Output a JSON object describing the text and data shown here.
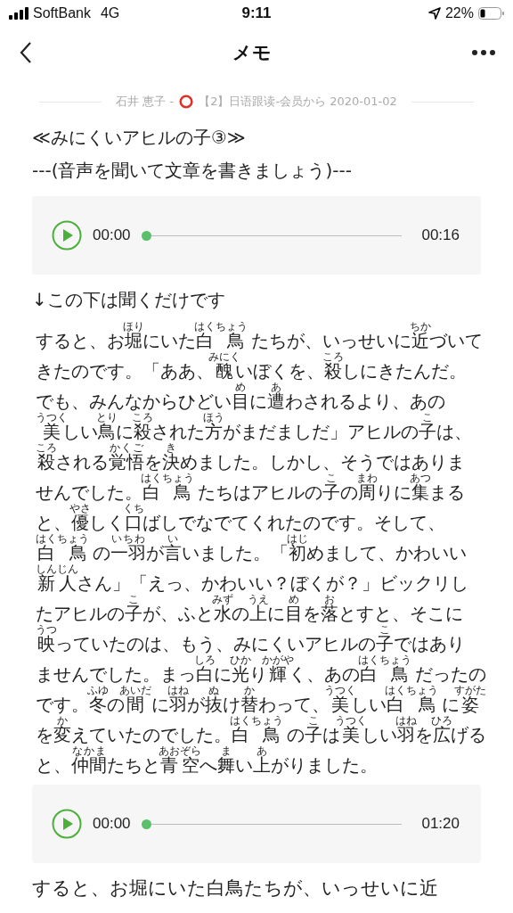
{
  "status_bar": {
    "carrier": "SoftBank",
    "network": "4G",
    "time": "9:11",
    "battery": "22%"
  },
  "nav": {
    "title": "メモ"
  },
  "meta": {
    "author": "石井 恵子 -",
    "source": "【2】日语跟读-会员から 2020-01-02"
  },
  "title_lines": [
    "≪みにくいアヒルの子③≫",
    "---(音声を聞いて文章を書きましょう)---"
  ],
  "players": [
    {
      "elapsed": "00:00",
      "duration": "00:16",
      "level": 0
    },
    {
      "elapsed": "00:00",
      "duration": "01:20",
      "level": 0
    }
  ],
  "note": "↓この下は聞くだけです",
  "passage": [
    [
      {
        "t": "すると、お"
      },
      {
        "t": "堀",
        "r": "ほり"
      },
      {
        "t": "にいた"
      },
      {
        "t": "白 鳥",
        "r": "はくちょう"
      },
      {
        "t": " たちが、いっせいに"
      },
      {
        "t": "近",
        "r": "ちか"
      },
      {
        "t": "づいて"
      }
    ],
    [
      {
        "t": "きたのです。「ああ、"
      },
      {
        "t": "醜",
        "r": "みにく"
      },
      {
        "t": "いぼくを、"
      },
      {
        "t": "殺",
        "r": "ころ"
      },
      {
        "t": "しにきたんだ。"
      }
    ],
    [
      {
        "t": "でも、みんなからひどい"
      },
      {
        "t": "目",
        "r": "め"
      },
      {
        "t": "に"
      },
      {
        "t": "遭",
        "r": "あ"
      },
      {
        "t": "わされるより、あの"
      }
    ],
    [
      {
        "t": "美",
        "r": "うつく"
      },
      {
        "t": "しい"
      },
      {
        "t": "鳥",
        "r": "とり"
      },
      {
        "t": "に"
      },
      {
        "t": "殺",
        "r": "ころ"
      },
      {
        "t": "された"
      },
      {
        "t": "方",
        "r": "ほう"
      },
      {
        "t": "がまだましだ」アヒルの"
      },
      {
        "t": "子",
        "r": "こ"
      },
      {
        "t": "は、"
      }
    ],
    [
      {
        "t": "殺",
        "r": "ころ"
      },
      {
        "t": "される"
      },
      {
        "t": "覚悟",
        "r": "かくご"
      },
      {
        "t": "を"
      },
      {
        "t": "決",
        "r": "き"
      },
      {
        "t": "めました。しかし、そうではありま"
      }
    ],
    [
      {
        "t": "せんでした。"
      },
      {
        "t": "白 鳥",
        "r": "はくちょう"
      },
      {
        "t": " たちはアヒルの"
      },
      {
        "t": "子",
        "r": "こ"
      },
      {
        "t": "の"
      },
      {
        "t": "周",
        "r": "まわ"
      },
      {
        "t": "りに"
      },
      {
        "t": "集",
        "r": "あつ"
      },
      {
        "t": "まる"
      }
    ],
    [
      {
        "t": "と、"
      },
      {
        "t": "優",
        "r": "やさ"
      },
      {
        "t": "しく"
      },
      {
        "t": "口",
        "r": "くち"
      },
      {
        "t": "ばしでなでてくれたのです。そして、"
      }
    ],
    [
      {
        "t": "白 鳥",
        "r": "はくちょう"
      },
      {
        "t": " の"
      },
      {
        "t": "一羽",
        "r": "いちわ"
      },
      {
        "t": "が"
      },
      {
        "t": "言",
        "r": "い"
      },
      {
        "t": "いました。「"
      },
      {
        "t": "初",
        "r": "はじ"
      },
      {
        "t": "めまして、かわいい"
      }
    ],
    [
      {
        "t": "新人",
        "r": "しんじん"
      },
      {
        "t": "さん」「えっ、かわいい？ぼくが？」ビックリし"
      }
    ],
    [
      {
        "t": "たアヒルの"
      },
      {
        "t": "子",
        "r": "こ"
      },
      {
        "t": "が、ふと"
      },
      {
        "t": "水",
        "r": "みず"
      },
      {
        "t": "の"
      },
      {
        "t": "上",
        "r": "うえ"
      },
      {
        "t": "に"
      },
      {
        "t": "目",
        "r": "め"
      },
      {
        "t": "を"
      },
      {
        "t": "落",
        "r": "お"
      },
      {
        "t": "とすと、そこに"
      }
    ],
    [
      {
        "t": "映",
        "r": "うつ"
      },
      {
        "t": "っていたのは、もう、みにくいアヒルの"
      },
      {
        "t": "子",
        "r": "こ"
      },
      {
        "t": "ではあり"
      }
    ],
    [
      {
        "t": "ませんでした。まっ"
      },
      {
        "t": "白",
        "r": "しろ"
      },
      {
        "t": "に"
      },
      {
        "t": "光",
        "r": "ひか"
      },
      {
        "t": "り"
      },
      {
        "t": "輝",
        "r": "かがや"
      },
      {
        "t": "く、あの"
      },
      {
        "t": "白 鳥",
        "r": "はくちょう"
      },
      {
        "t": " だったの"
      }
    ],
    [
      {
        "t": "です。"
      },
      {
        "t": "冬",
        "r": "ふゆ"
      },
      {
        "t": "の"
      },
      {
        "t": "間",
        "r": "あいだ"
      },
      {
        "t": " に"
      },
      {
        "t": "羽",
        "r": "はね"
      },
      {
        "t": "が"
      },
      {
        "t": "抜",
        "r": "ぬ"
      },
      {
        "t": "け"
      },
      {
        "t": "替",
        "r": "か"
      },
      {
        "t": "わって、"
      },
      {
        "t": "美",
        "r": "うつく"
      },
      {
        "t": "しい"
      },
      {
        "t": "白 鳥",
        "r": "はくちょう"
      },
      {
        "t": " に"
      },
      {
        "t": "姿",
        "r": "すがた"
      }
    ],
    [
      {
        "t": "を"
      },
      {
        "t": "変",
        "r": "か"
      },
      {
        "t": "えていたのでした。"
      },
      {
        "t": "白 鳥",
        "r": "はくちょう"
      },
      {
        "t": " の"
      },
      {
        "t": "子",
        "r": "こ"
      },
      {
        "t": "は"
      },
      {
        "t": "美",
        "r": "うつく"
      },
      {
        "t": "しい"
      },
      {
        "t": "羽",
        "r": "はね"
      },
      {
        "t": "を"
      },
      {
        "t": "広",
        "r": "ひろ"
      },
      {
        "t": "げる"
      }
    ],
    [
      {
        "t": "と、"
      },
      {
        "t": "仲間",
        "r": "なかま"
      },
      {
        "t": "たちと"
      },
      {
        "t": "青空",
        "r": "あおぞら"
      },
      {
        "t": "へ"
      },
      {
        "t": "舞",
        "r": "ま"
      },
      {
        "t": "い"
      },
      {
        "t": "上",
        "r": "あ"
      },
      {
        "t": "がりました。"
      }
    ]
  ],
  "closing_text": "すると、お堀にいた白鳥たちが、いっせいに近"
}
